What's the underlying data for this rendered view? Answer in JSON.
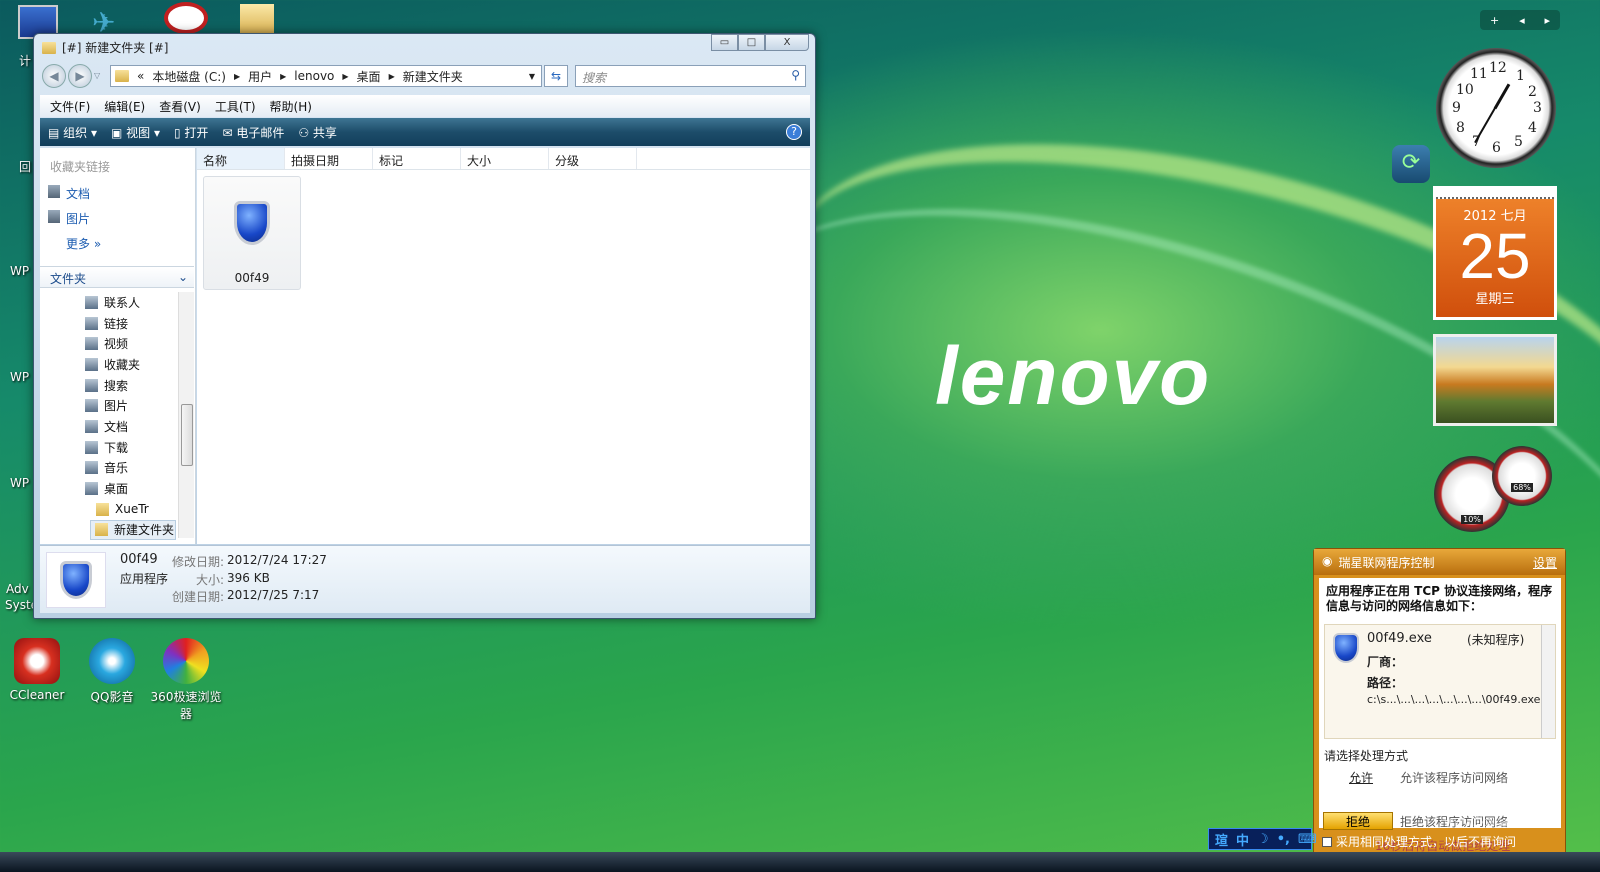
{
  "desktop": {
    "logo": "lenovo",
    "left_icons": [
      "计",
      "回",
      "WP",
      "WP",
      "WP",
      "Adv",
      "Syste"
    ],
    "bottom_icons": [
      {
        "label": "CCleaner",
        "color": "#d83020"
      },
      {
        "label": "QQ影音",
        "color": "#2aa8e0"
      },
      {
        "label": "360极速浏览器",
        "color": "#e8a020"
      }
    ]
  },
  "explorer": {
    "title": "[#] 新建文件夹 [#]",
    "window_buttons": [
      "▭",
      "□",
      "X"
    ],
    "breadcrumb": [
      "«",
      "本地磁盘 (C:)",
      "用户",
      "lenovo",
      "桌面",
      "新建文件夹"
    ],
    "search_placeholder": "搜索",
    "menu": [
      "文件(F)",
      "编辑(E)",
      "查看(V)",
      "工具(T)",
      "帮助(H)"
    ],
    "toolbar": [
      "组织 ▾",
      "视图 ▾",
      "打开",
      "电子邮件",
      "共享"
    ],
    "help": "?",
    "favorites_header": "收藏夹链接",
    "favorites": [
      "文档",
      "图片"
    ],
    "more": "更多 »",
    "folders_header": "文件夹",
    "tree": [
      "联系人",
      "链接",
      "视频",
      "收藏夹",
      "搜索",
      "图片",
      "文档",
      "下载",
      "音乐",
      "桌面",
      "XueTr",
      "新建文件夹"
    ],
    "columns": [
      "名称",
      "拍摄日期",
      "标记",
      "大小",
      "分级"
    ],
    "files": [
      {
        "name": "00f49"
      }
    ],
    "details": {
      "name": "00f49",
      "type": "应用程序",
      "modified_label": "修改日期:",
      "modified": "2012/7/24 17:27",
      "size_label": "大小:",
      "size": "396 KB",
      "created_label": "创建日期:",
      "created": "2012/7/25 7:17"
    }
  },
  "widgets": {
    "sidebar_controls": [
      "+",
      "◂",
      "▸"
    ],
    "clock_numbers": [
      "12",
      "1",
      "2",
      "3",
      "4",
      "5",
      "6",
      "7",
      "8",
      "9",
      "10",
      "11"
    ],
    "calendar": {
      "year_month": "2012 七月",
      "day": "25",
      "weekday": "星期三"
    },
    "gauges": [
      "10%",
      "68%"
    ]
  },
  "popup": {
    "title": "瑞星联网程序控制",
    "settings": "设置",
    "message": "应用程序正在用 TCP 协议连接网络，程序信息与访问的网络信息如下：",
    "exe": "00f49.exe",
    "exe_status": "(未知程序)",
    "vendor_label": "厂商：",
    "path_label": "路径：",
    "path": "c:\\s...\\...\\...\\...\\...\\...\\...\\00f49.exe",
    "choose": "请选择处理方式",
    "allow": "允许",
    "allow_desc": "允许该程序访问网络",
    "deny": "拒绝",
    "deny_desc": "拒绝该程序访问网络",
    "countdown": "16秒后将自动做拒绝处理",
    "remember": "采用相同处理方式，以后不再询问",
    "watermark": "www.ikaka.com"
  },
  "tray": [
    "瑄",
    "中",
    "☽",
    "•,",
    "⌨"
  ]
}
